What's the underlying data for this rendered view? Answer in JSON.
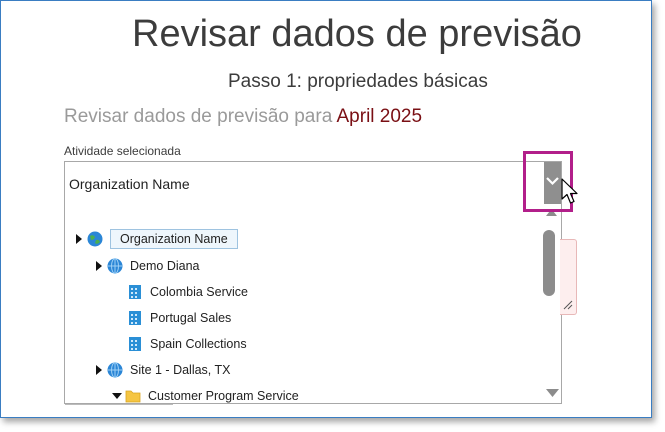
{
  "page": {
    "title": "Revisar dados de previsão",
    "step": "Passo 1: propriedades básicas",
    "review_prefix": "Revisar dados de previsão para",
    "review_month": "April 2025",
    "activity_label": "Atividade selecionada"
  },
  "combo": {
    "value": "Organization Name",
    "tree": [
      {
        "label": "Organization Name",
        "icon": "globe-icon",
        "caret": "right",
        "selected": true
      },
      {
        "label": "Demo Diana",
        "icon": "globe-icon",
        "caret": "right"
      },
      {
        "label": "Colombia Service",
        "icon": "building-icon"
      },
      {
        "label": "Portugal Sales",
        "icon": "building-icon"
      },
      {
        "label": "Spain Collections",
        "icon": "building-icon"
      },
      {
        "label": "Site 1 - Dallas, TX",
        "icon": "globe-icon",
        "caret": "right"
      },
      {
        "label": "Customer Program Service",
        "icon": "folder-icon",
        "caret": "down"
      }
    ]
  },
  "colors": {
    "accent_highlight": "#b21f8a",
    "month": "#7a0f14",
    "frame_border": "#3a7dc2"
  }
}
